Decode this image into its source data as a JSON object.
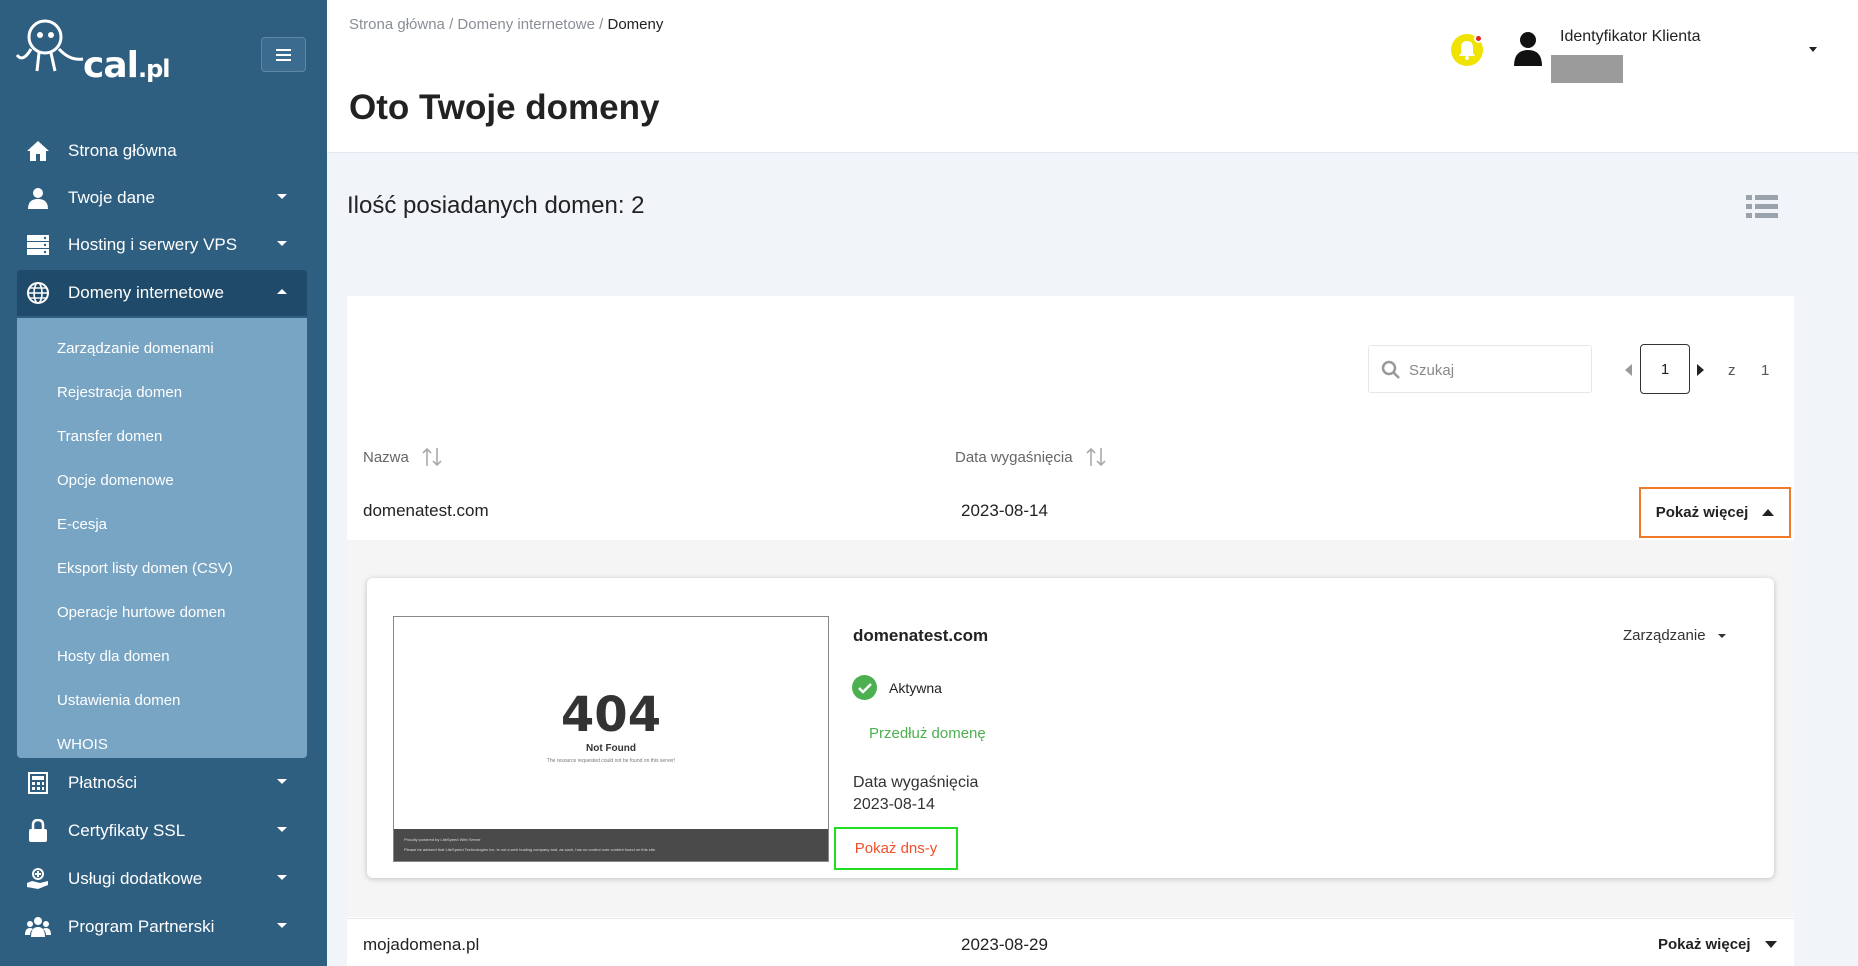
{
  "brand": {
    "logo_text": "cal",
    "logo_suffix": ".pl"
  },
  "sidebar": {
    "items": [
      {
        "label": "Strona główna",
        "icon": "home-icon"
      },
      {
        "label": "Twoje dane",
        "icon": "user-icon"
      },
      {
        "label": "Hosting i serwery VPS",
        "icon": "server-icon"
      },
      {
        "label": "Domeny internetowe",
        "icon": "globe-icon"
      },
      {
        "label": "Płatności",
        "icon": "calculator-icon"
      },
      {
        "label": "Certyfikaty SSL",
        "icon": "lock-icon"
      },
      {
        "label": "Usługi dodatkowe",
        "icon": "hand-plus-icon"
      },
      {
        "label": "Program Partnerski",
        "icon": "group-icon"
      }
    ],
    "submenu": [
      "Zarządzanie domenami",
      "Rejestracja domen",
      "Transfer domen",
      "Opcje domenowe",
      "E-cesja",
      "Eksport listy domen (CSV)",
      "Operacje hurtowe domen",
      "Hosty dla domen",
      "Ustawienia domen",
      "WHOIS"
    ]
  },
  "header": {
    "breadcrumb": [
      "Strona główna /",
      "Domeny internetowe /",
      "Domeny"
    ],
    "title": "Oto Twoje domeny",
    "client_label": "Identyfikator Klienta"
  },
  "main": {
    "domain_count": "Ilość posiadanych domen: 2",
    "search_placeholder": "Szukaj",
    "pagination": {
      "current": "1",
      "of": "z",
      "total": "1"
    },
    "columns": [
      "Nazwa",
      "Data wygaśnięcia"
    ],
    "rows": [
      {
        "name": "domenatest.com",
        "expires": "2023-08-14",
        "action": "Pokaż więcej"
      },
      {
        "name": "mojadomena.pl",
        "expires": "2023-08-29",
        "action": "Pokaż więcej"
      }
    ],
    "details": {
      "domain": "domenatest.com",
      "manage": "Zarządzanie",
      "status": "Aktywna",
      "renew": "Przedłuż domenę",
      "expires_label": "Data wygaśnięcia",
      "expires_value": "2023-08-14",
      "dns_button": "Pokaż dns-y",
      "thumbnail": {
        "code": "404",
        "title": "Not Found",
        "message": "The resource requested could not be found on this server!",
        "footer1": "Proudly powered by LiteSpeed Web Server",
        "footer2": "Please be advised that LiteSpeed Technologies Inc. is not a web hosting company and, as such, has no control over content found on this site."
      }
    }
  },
  "colors": {
    "sidebar": "#2f5f80",
    "sidebar_active": "#1f4a69",
    "submenu": "#79a5c4",
    "accent_orange": "#f07a2b",
    "highlight_green": "#22dd22",
    "success": "#4caf50",
    "dns_text": "#f0502b",
    "bell": "#f0e300"
  }
}
